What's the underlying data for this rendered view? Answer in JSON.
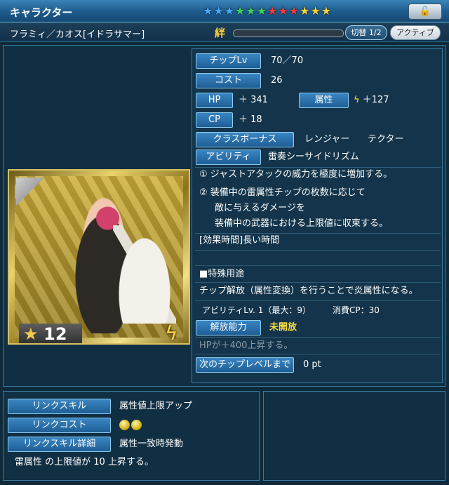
{
  "header": {
    "title": "キャラクター",
    "stars": [
      {
        "glyph": "★",
        "color": "#4aa8ff"
      },
      {
        "glyph": "★",
        "color": "#4aa8ff"
      },
      {
        "glyph": "★",
        "color": "#4aa8ff"
      },
      {
        "glyph": "★",
        "color": "#40d060"
      },
      {
        "glyph": "★",
        "color": "#40d060"
      },
      {
        "glyph": "★",
        "color": "#40d060"
      },
      {
        "glyph": "★",
        "color": "#ff3a3a"
      },
      {
        "glyph": "★",
        "color": "#ff3a3a"
      },
      {
        "glyph": "★",
        "color": "#ff3a3a"
      },
      {
        "glyph": "★",
        "color": "#ffd23a"
      },
      {
        "glyph": "★",
        "color": "#ffd23a"
      },
      {
        "glyph": "★",
        "color": "#ffd23a"
      }
    ],
    "lock_icon": "🔓"
  },
  "subheader": {
    "name": "フラミィ／カオス[イドラサマー]",
    "kizuna_label": "絆",
    "kizuna_progress": 0,
    "switch_label": "切替 1/2",
    "active_label": "アクティブ"
  },
  "card": {
    "rarity": "12",
    "rarity_star": "★",
    "element_icon": "lightning-icon",
    "element_glyph": "ϟ"
  },
  "stats": {
    "chip_lv_label": "チップLv",
    "chip_lv_value": "70／70",
    "cost_label": "コスト",
    "cost_value": "26",
    "hp_label": "HP",
    "hp_value": "＋ 341",
    "attr_label": "属性",
    "attr_value": "＋127",
    "cp_label": "CP",
    "cp_value": "＋  18",
    "class_label": "クラスボーナス",
    "class_value_1": "レンジャー",
    "class_value_2": "テクター",
    "ability_label": "アビリティ",
    "ability_value": "雷奏シーサイドリズム"
  },
  "ability_text": {
    "line1": "① ジャストアタックの威力を極度に増加する。",
    "line2": "② 装備中の雷属性チップの枚数に応じて",
    "line3": "敵に与えるダメージを",
    "line4": "装備中の武器における上限値に収束する。",
    "line5": "[効果時間]長い時間"
  },
  "special": {
    "heading": "■特殊用途",
    "desc": "チップ解放（属性変換）を行うことで炎属性になる。",
    "ability_lv": "アビリティLv. 1（最大：9）",
    "cp_cost": "消費CP：30",
    "release_label": "解放能力",
    "release_value": "未開放",
    "release_desc": "HPが＋400上昇する。",
    "next_label": "次のチップレベルまで",
    "next_value": "0 pt"
  },
  "link": {
    "skill_label": "リンクスキル",
    "skill_value": "属性値上限アップ",
    "cost_label": "リンクコスト",
    "detail_label": "リンクスキル詳細",
    "detail_value": "属性一致時発動",
    "detail_desc": "雷属性 の上限値が 10 上昇する。"
  }
}
